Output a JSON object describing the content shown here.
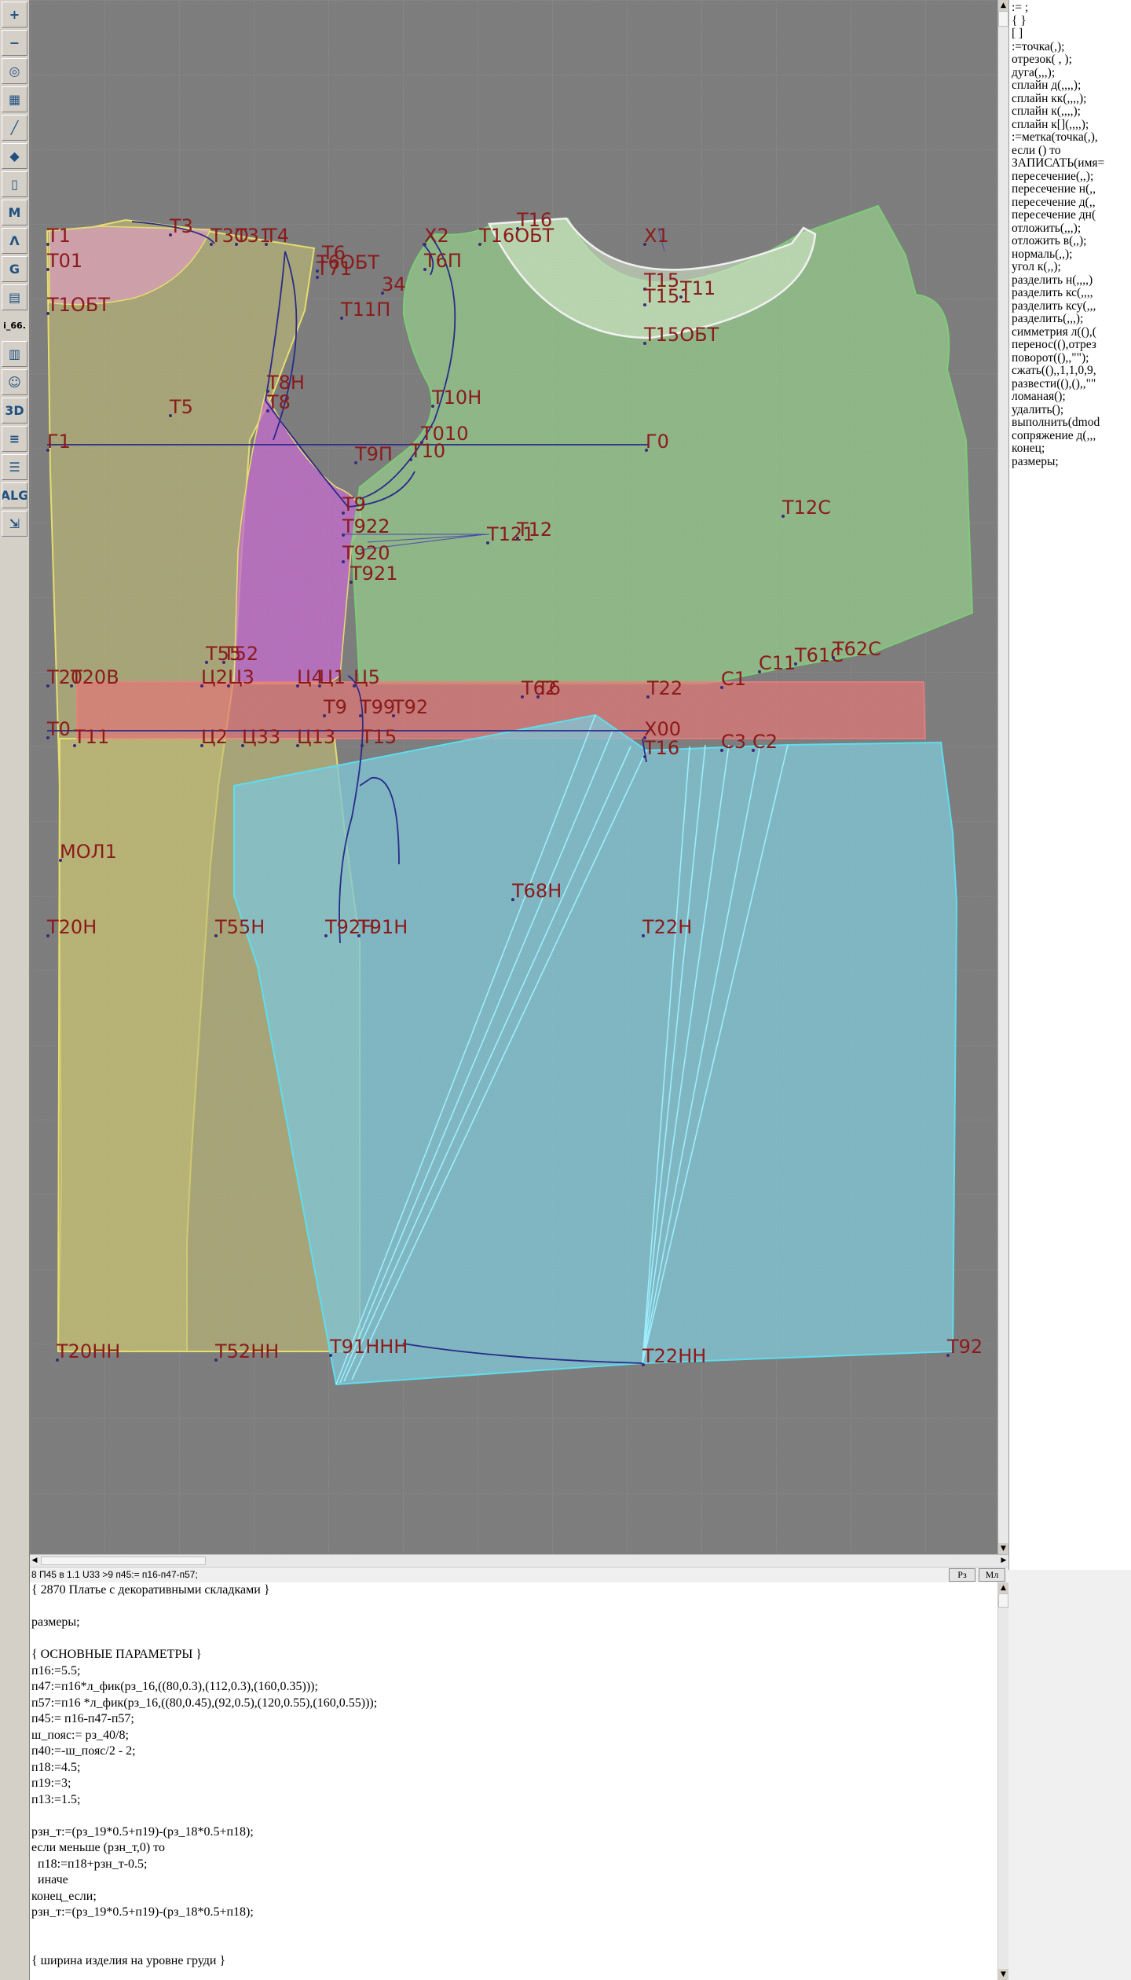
{
  "toolbar": {
    "tools": [
      {
        "icon": "zoom-in-icon",
        "glyph": "+"
      },
      {
        "icon": "zoom-out-icon",
        "glyph": "−"
      },
      {
        "icon": "zoom-fit-icon",
        "glyph": "◎"
      },
      {
        "icon": "grid-icon",
        "glyph": "▦"
      },
      {
        "icon": "measure-line-icon",
        "glyph": "╱"
      },
      {
        "icon": "layer-icon",
        "glyph": "◆"
      },
      {
        "icon": "pattern-piece-icon",
        "glyph": "▯"
      },
      {
        "icon": "m-tool-icon",
        "glyph": "M"
      },
      {
        "icon": "compass-icon",
        "glyph": "Λ"
      },
      {
        "icon": "g-tool-icon",
        "glyph": "G"
      },
      {
        "icon": "ruler-icon",
        "glyph": "▤"
      },
      {
        "icon": "version-label",
        "glyph": "i_66."
      },
      {
        "icon": "notebook-icon",
        "glyph": "▥"
      },
      {
        "icon": "mannequin-icon",
        "glyph": "☺"
      },
      {
        "icon": "3d-view-icon",
        "glyph": "3D"
      },
      {
        "icon": "document-icon",
        "glyph": "≡"
      },
      {
        "icon": "list-icon",
        "glyph": "☰"
      },
      {
        "icon": "algorithm-icon",
        "glyph": "ALG"
      },
      {
        "icon": "export-icon",
        "glyph": "⇲"
      }
    ]
  },
  "command_panel": {
    "commands": [
      ":= ;",
      "{ }",
      "[ ]",
      ":=точка(,);",
      "отрезок( , );",
      "дуга(,,,);",
      "сплайн д(,,,,);",
      "сплайн кк(,,,,);",
      "сплайн к(,,,,);",
      "сплайн к[](,,,,);",
      ":=метка(точка(,),",
      "если () то",
      "ЗАПИСАТЬ(имя=",
      "пересечение(,,);",
      "пересечение н(,,",
      "пересечение д(,,",
      "пересечение дн(",
      "отложить(,,,);",
      "отложить в(,,);",
      "нормаль(,,);",
      "угол к(,,);",
      "разделить н(,,,,)",
      "разделить кс(,,,,",
      "разделить ксу(,,,",
      "разделить(,,,);",
      "симметрия л((),(",
      "перенос((),отрез",
      "поворот((),,\"\");",
      "сжать((),,1,1,0,9,",
      "развести((),(),,\"\"",
      "ломаная();",
      "удалить();",
      "выполнить(dmod",
      "сопряжение д(,,,",
      "конец;",
      "размеры;"
    ]
  },
  "canvas": {
    "point_labels": [
      "Т1",
      "Т3",
      "Т3О",
      "Т31",
      "Т4",
      "Т6",
      "Т6ОБТ",
      "Т01",
      "Т1ОБТ",
      "Т71",
      "Т11П",
      "Х2",
      "Т16",
      "Т16ОБТ",
      "Х1",
      "Т15",
      "Т151",
      "Т11",
      "Т15ОБТ",
      "34",
      "Т6П",
      "Т8Н",
      "Т8",
      "Т5",
      "Т10Н",
      "Т010",
      "Т9П",
      "Т10",
      "Г1",
      "Г0",
      "Т9",
      "Т922",
      "Т920",
      "Т921",
      "Т121",
      "Т12",
      "Т12С",
      "С11",
      "Т61С",
      "Т62С",
      "Т20",
      "Т20В",
      "Т55",
      "Т52",
      "Ц2",
      "Ц3",
      "Ц4",
      "Ц1",
      "Ц5",
      "Т9",
      "Т99",
      "Т92",
      "Т62",
      "Т6",
      "Т22",
      "С1",
      "Т0",
      "Т11",
      "Ц2",
      "Ц33",
      "Ц13",
      "Т15",
      "Х00",
      "Т16",
      "С3",
      "С2",
      "МОЛ1",
      "Т68Н",
      "Т20Н",
      "Т55Н",
      "Т92Н",
      "Т91Н",
      "Т22Н",
      "Т20НН",
      "Т52НН",
      "Т91ННН",
      "Т22НН",
      "Т92"
    ]
  },
  "statusbar": {
    "text": "8 П45 в 1.1 U33  >9 п45:= п16-п47-п57;",
    "button_rz": "Рз",
    "button_ml": "Мл"
  },
  "editor": {
    "lines": [
      "{ 2870 Платье с декоративными складками }",
      "",
      "размеры;",
      "",
      "{ ОСНОВНЫЕ ПАРАМЕТРЫ }",
      "п16:=5.5;",
      "п47:=п16*л_фик(рз_16,((80,0.3),(112,0.3),(160,0.35)));",
      "п57:=п16 *л_фик(рз_16,((80,0.45),(92,0.5),(120,0.55),(160,0.55)));",
      "п45:= п16-п47-п57;",
      "ш_пояс:= рз_40/8;",
      "п40:=-ш_пояс/2 - 2;",
      "п18:=4.5;",
      "п19:=3;",
      "п13:=1.5;",
      "",
      "рзн_т:=(рз_19*0.5+п19)-(рз_18*0.5+п18);",
      "если меньше (рзн_т,0) то",
      "  п18:=п18+рзн_т-0.5;",
      "  иначе",
      "конец_если;",
      "рзн_т:=(рз_19*0.5+п19)-(рз_18*0.5+п18);",
      "",
      "",
      "{ ширина изделия на уровне груди }"
    ]
  }
}
